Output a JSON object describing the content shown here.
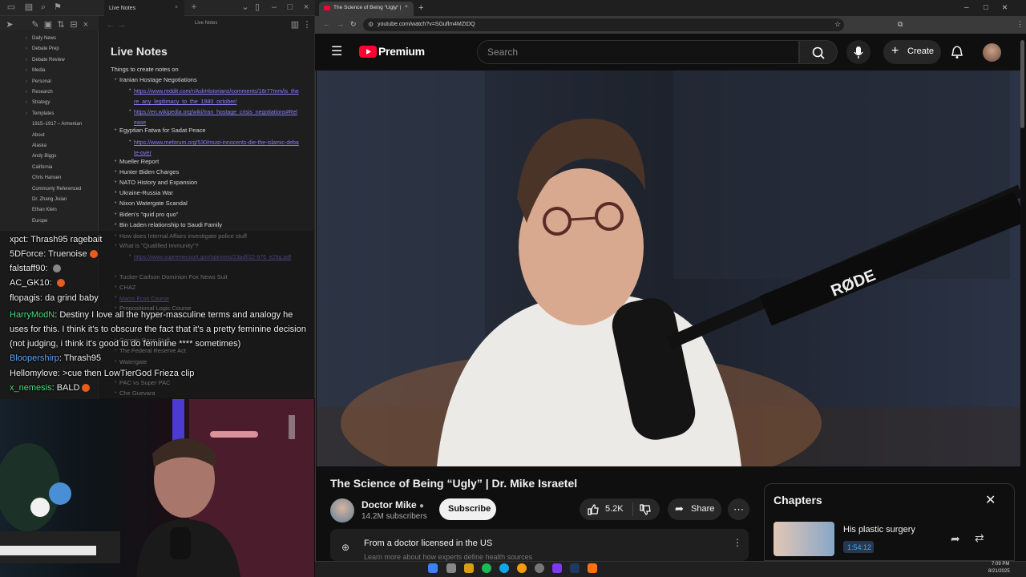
{
  "obsidian": {
    "tab_title": "Live Notes",
    "editor_title": "Live Notes",
    "note_title": "Live Notes",
    "files": [
      "Daily News",
      "Debate Prep",
      "Debate Review",
      "Media",
      "Personal",
      "Research",
      "Strategy",
      "Templates",
      "1915–1917 – Armenian",
      "About",
      "Alaska",
      "Andy Biggs",
      "California",
      "Chris Hansen",
      "Commonly Referenced",
      "Dr. Zhang Jixian",
      "Ethan Klein",
      "Europe"
    ],
    "intro": "Things to create notes on",
    "items": [
      {
        "text": "Iranian Hostage Negotiations",
        "level": 1
      },
      {
        "text": "https://www.reddit.com/r/AskHistorians/comments/16r77mm/is_there_any_legitimacy_to_the_1980_october/",
        "level": 2,
        "link": true
      },
      {
        "text": "https://en.wikipedia.org/wiki/Iran_hostage_crisis_negotiations#Release",
        "level": 2,
        "link": true
      },
      {
        "text": "Egyptian Fatwa for Sadat Peace",
        "level": 1
      },
      {
        "text": "https://www.meforum.org/530/must-innocents-die-the-islamic-debate-over",
        "level": 2,
        "link": true
      },
      {
        "text": "Mueller Report",
        "level": 1
      },
      {
        "text": "Hunter Biden Charges",
        "level": 1
      },
      {
        "text": "NATO History and Expansion",
        "level": 1
      },
      {
        "text": "Ukraine-Russia War",
        "level": 1
      },
      {
        "text": "Nixon Watergate Scandal",
        "level": 1
      },
      {
        "text": "Biden's \"quid pro quo\"",
        "level": 1
      },
      {
        "text": "Bin Laden relationship to Saudi Family",
        "level": 1
      },
      {
        "text": "How does Internal Affairs investigate police stuff",
        "level": 1
      },
      {
        "text": "What is \"Qualified Immunity\"?",
        "level": 1
      },
      {
        "text": "https://www.supremecourt.gov/opinions/23pdf/22-976_e29g.pdf",
        "level": 2,
        "link": true
      },
      {
        "text": "Tucker Carlson Dominion Fox News Suit",
        "level": 1
      },
      {
        "text": "CHAZ",
        "level": 1
      },
      {
        "text": "Macro Econ Course",
        "level": 1,
        "link": true
      },
      {
        "text": "Propositional Logic Course",
        "level": 1
      },
      {
        "text": "Genetic Race Stuff",
        "level": 1
      },
      {
        "text": "The Federal Reserve Act",
        "level": 1
      },
      {
        "text": "Watergate",
        "level": 1
      },
      {
        "text": "PAC vs Super PAC",
        "level": 1
      },
      {
        "text": "Che Guevara",
        "level": 1
      }
    ]
  },
  "chat": [
    {
      "user": "xpct",
      "user_color": "#f1f1f1",
      "msg": "Thrash95 ragebait"
    },
    {
      "user": "5DForce",
      "user_color": "#f1f1f1",
      "msg": "Truenoise"
    },
    {
      "user": "falstaff90",
      "user_color": "#f1f1f1",
      "msg": ""
    },
    {
      "user": "AC_GK10",
      "user_color": "#f1f1f1",
      "msg": ""
    },
    {
      "user": "flopagis",
      "user_color": "#f1f1f1",
      "msg": "da grind baby"
    },
    {
      "user": "HarryModN",
      "user_color": "#4ade80",
      "msg": "Destiny I love all the hyper-masculine terms and analogy he uses for this. I think it's to obscure the fact that it's a pretty feminine decision (not judging, i think it's good to do feminine **** sometimes)"
    },
    {
      "user": "Bloopershirp",
      "user_color": "#60a5fa",
      "msg": "Thrash95"
    },
    {
      "user": "Hellomylove",
      "user_color": "#f1f1f1",
      "msg": ">cue then LowTierGod Frieza clip"
    },
    {
      "user": "x_nemesis",
      "user_color": "#4ade80",
      "msg": "BALD"
    }
  ],
  "browser": {
    "tab_title": "The Science of Being “Ugly” |",
    "url": "youtube.com/watch?v=SGuflm4MZtDQ"
  },
  "youtube": {
    "brand": "Premium",
    "search_placeholder": "Search",
    "create_label": "Create",
    "video_title": "The Science of Being “Ugly” | Dr. Mike Israetel",
    "channel_name": "Doctor Mike",
    "channel_subs": "14.2M subscribers",
    "subscribe_label": "Subscribe",
    "like_count": "5.2K",
    "share_label": "Share",
    "more_label": "⋯",
    "notice_text": "From a doctor licensed in the US",
    "notice_sub": "Learn more about how experts define health sources",
    "mic_brand": "RØDE",
    "accent": "#ff0033"
  },
  "chapters": {
    "title": "Chapters",
    "item_name": "His plastic surgery",
    "item_time": "1:54:12"
  },
  "taskbar": {
    "time": "7:09 PM",
    "date": "8/21/2025"
  }
}
